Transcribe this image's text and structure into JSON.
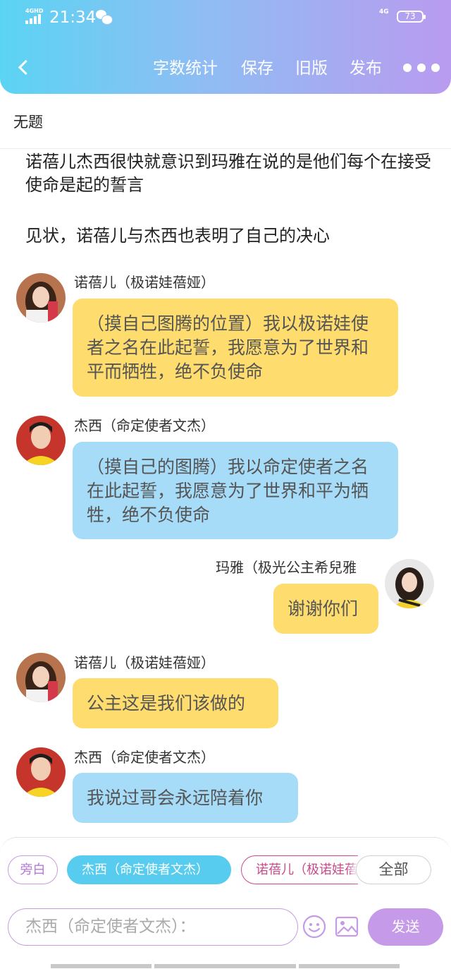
{
  "status_bar": {
    "network_left": "4GHD",
    "time": "21:34",
    "network_right": "4G",
    "battery": "73"
  },
  "header": {
    "back_icon": "chevron-left-icon",
    "actions": [
      "字数统计",
      "保存",
      "旧版",
      "发布"
    ],
    "more_icon": "more-dots-icon"
  },
  "title": "无题",
  "narration": [
    "诺蓓儿杰西很快就意识到玛雅在说的是他们每个在接受使命是起的誓言",
    "见状，诺蓓儿与杰西也表明了自己的决心"
  ],
  "messages": [
    {
      "speaker": "诺蓓儿（极诺娃蓓娅）",
      "side": "left",
      "bubble": "yellow",
      "text": "（摸自己图腾的位置）我以极诺娃使者之名在此起誓，我愿意为了世界和平而牺牲，绝不负使命"
    },
    {
      "speaker": "杰西（命定使者文杰）",
      "side": "left",
      "bubble": "blue",
      "text": "（摸自己的图腾）我以命定使者之名在此起誓，我愿意为了世界和平为牺牲，绝不负使命"
    },
    {
      "speaker": "玛雅（极光公主希兒雅",
      "side": "right",
      "bubble": "yellow",
      "text": "谢谢你们"
    },
    {
      "speaker": "诺蓓儿（极诺娃蓓娅）",
      "side": "left",
      "bubble": "yellow",
      "text": "公主这是我们该做的"
    },
    {
      "speaker": "杰西（命定使者文杰）",
      "side": "left",
      "bubble": "blue",
      "text": "我说过哥会永远陪着你"
    }
  ],
  "roles": {
    "narrator": "旁白",
    "jessie": "杰西（命定使者文杰）",
    "noel": "诺蓓儿（极诺娃蓓娅）",
    "all": "全部"
  },
  "composer": {
    "placeholder": "杰西（命定使者文杰）：",
    "emoji_icon": "emoji-icon",
    "image_icon": "image-icon",
    "send": "发送"
  },
  "colors": {
    "header_gradient": [
      "#5bd4f3",
      "#b99bef"
    ],
    "bubble_yellow": "#fedc6d",
    "bubble_blue": "#a6dcf8",
    "send_button": "#c49ae9"
  }
}
